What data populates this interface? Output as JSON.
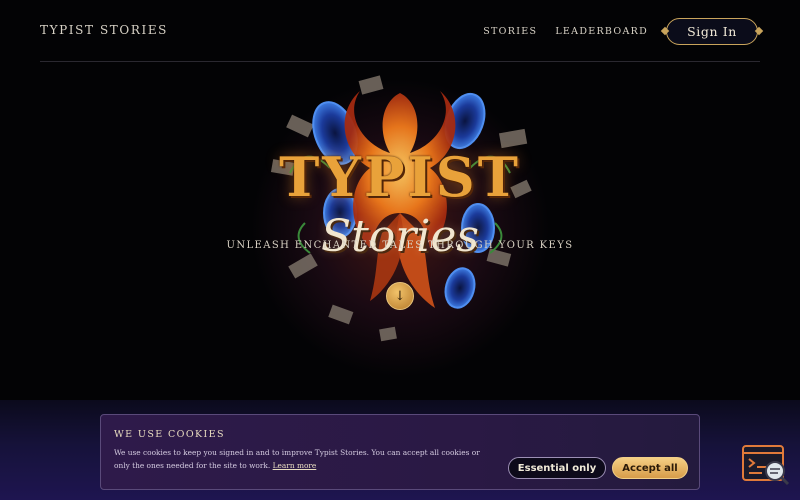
{
  "header": {
    "brand": "TYPIST STORIES",
    "nav": [
      {
        "label": "STORIES"
      },
      {
        "label": "LEADERBOARD"
      }
    ],
    "signin_label": "Sign In"
  },
  "hero": {
    "title_line1": "TYPIST",
    "title_line2": "Stories",
    "tagline": "UNLEASH ENCHANTED TALES THROUGH YOUR KEYS",
    "scroll_icon": "arrow-down-icon"
  },
  "cookie": {
    "title": "WE USE COOKIES",
    "text": "We use cookies to keep you signed in and to improve Typist Stories. You can accept all cookies or only the ones needed for the site to work.",
    "link_label": "Learn more",
    "essential_label": "Essential only",
    "accept_label": "Accept all"
  },
  "widget": {
    "icon": "console-search-icon"
  },
  "colors": {
    "gold": "#c9a45c",
    "accent_orange": "#e9a23a",
    "banner_purple": "#2e1a4a",
    "background": "#030305"
  }
}
